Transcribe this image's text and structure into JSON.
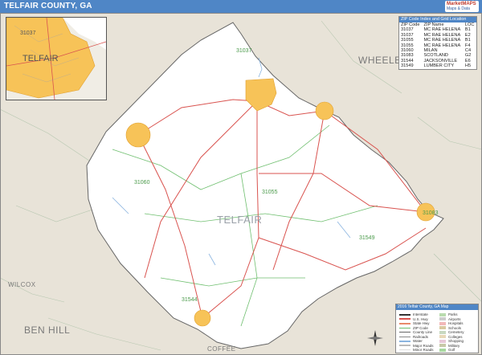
{
  "title": "TELFAIR COUNTY, GA",
  "brand": {
    "line1": "MarketMAPS",
    "line2": "Maps & Data"
  },
  "county_label": "TELFAIR",
  "neighbors": [
    {
      "name": "WHEELER"
    },
    {
      "name": "BEN HILL"
    },
    {
      "name": "WILCOX"
    },
    {
      "name": "COFFEE"
    }
  ],
  "map_zip_labels": [
    "31037",
    "31060",
    "31055",
    "31549",
    "31544",
    "31083"
  ],
  "inset": {
    "label": "TELFAIR",
    "zip": "31037"
  },
  "zip_table": {
    "header": "ZIP Code Index and Grid Location",
    "columns": [
      "ZIP Code",
      "ZIP Name",
      "LOC"
    ],
    "rows": [
      [
        "31037",
        "MC RAE HELENA",
        "B1"
      ],
      [
        "31037",
        "MC RAE HELENA",
        "E2"
      ],
      [
        "31055",
        "MC RAE HELENA",
        "B1"
      ],
      [
        "31055",
        "MC RAE HELENA",
        "F4"
      ],
      [
        "31060",
        "MILAN",
        "C4"
      ],
      [
        "31083",
        "SCOTLAND",
        "G2"
      ],
      [
        "31544",
        "JACKSONVILLE",
        "E6"
      ],
      [
        "31549",
        "LUMBER CITY",
        "H5"
      ]
    ]
  },
  "legend": {
    "header": "2016 Telfair County, GA Map",
    "left": [
      "Interstate",
      "U.S. Hwy",
      "State Hwy",
      "ZIP Code",
      "County Line",
      "Railroads",
      "Water",
      "Major Roads",
      "Minor Roads"
    ],
    "right": [
      "Parks",
      "Airports",
      "Hospitals",
      "Schools",
      "Cemetery",
      "Colleges",
      "Shopping",
      "Military",
      "Golf"
    ]
  },
  "colors": {
    "title_bar": "#4f86c6",
    "county_fill": "#ffffff",
    "outside_fill": "#e8e3d8",
    "city_fill": "#f7c358",
    "highway": "#d9534f",
    "zip_line": "#6fbf6f"
  }
}
